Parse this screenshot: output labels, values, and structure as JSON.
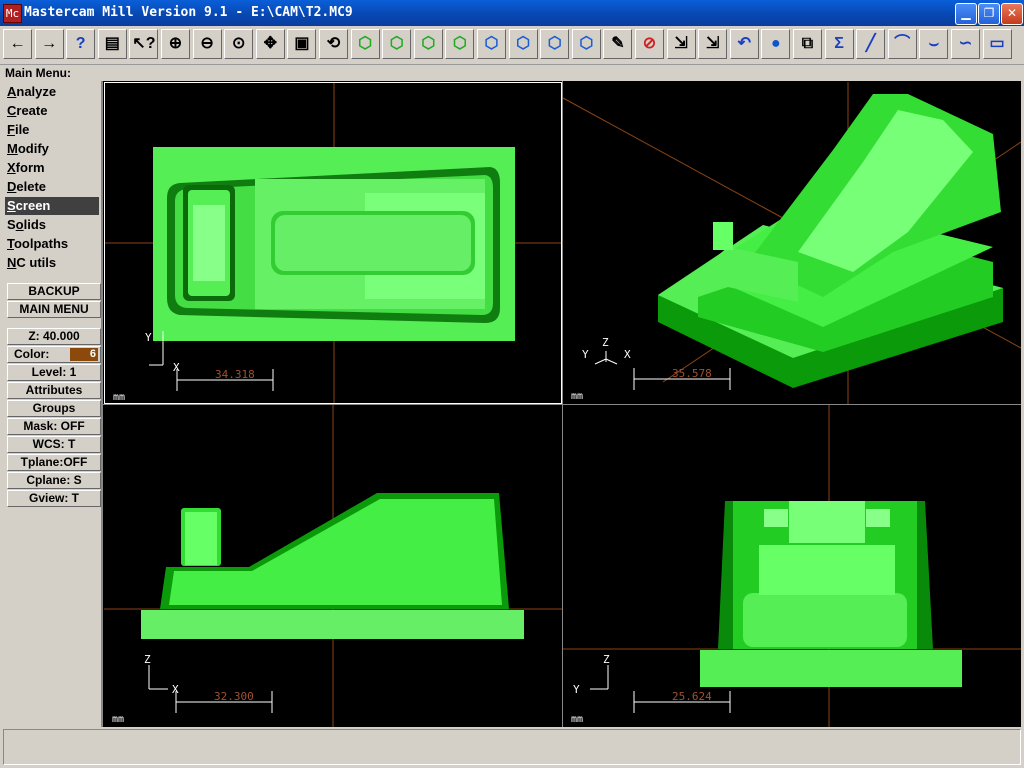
{
  "window": {
    "title": "Mastercam Mill Version 9.1 - E:\\CAM\\T2.MC9",
    "app_icon": "Mc"
  },
  "window_buttons": {
    "minimize": "▁",
    "maximize": "❐",
    "close": "✕"
  },
  "toolbar": {
    "buttons": [
      {
        "name": "back-icon",
        "glyph": "←"
      },
      {
        "name": "forward-icon",
        "glyph": "→"
      },
      {
        "name": "help-icon",
        "glyph": "?"
      },
      {
        "name": "file-cabinet-icon",
        "glyph": "▤"
      },
      {
        "name": "analyze-icon",
        "glyph": "↖?"
      },
      {
        "name": "zoom-icon",
        "glyph": "⊕"
      },
      {
        "name": "unzoom-icon",
        "glyph": "⊖"
      },
      {
        "name": "zoom-fit-icon",
        "glyph": "⊙"
      },
      {
        "name": "pan-icon",
        "glyph": "✥"
      },
      {
        "name": "select-icon",
        "glyph": "▣"
      },
      {
        "name": "rotate-icon",
        "glyph": "⟲"
      },
      {
        "name": "view-iso-green-icon",
        "glyph": "⬡"
      },
      {
        "name": "view-front-green-icon",
        "glyph": "⬡"
      },
      {
        "name": "view-side-green-icon",
        "glyph": "⬡"
      },
      {
        "name": "view-top-green-icon",
        "glyph": "⬡"
      },
      {
        "name": "view-iso-blue-icon",
        "glyph": "⬡"
      },
      {
        "name": "view-front-blue-icon",
        "glyph": "⬡"
      },
      {
        "name": "view-side-blue-icon",
        "glyph": "⬡"
      },
      {
        "name": "view-top-blue-icon",
        "glyph": "⬡"
      },
      {
        "name": "pencil-icon",
        "glyph": "✎"
      },
      {
        "name": "erase-icon",
        "glyph": "⊘"
      },
      {
        "name": "transform-icon",
        "glyph": "⇲"
      },
      {
        "name": "transform-multi-icon",
        "glyph": "⇲"
      },
      {
        "name": "undo-icon",
        "glyph": "↶"
      },
      {
        "name": "sphere-icon",
        "glyph": "●"
      },
      {
        "name": "scale-icon",
        "glyph": "⧉"
      },
      {
        "name": "sum-icon",
        "glyph": "Σ"
      },
      {
        "name": "line-icon",
        "glyph": "╱"
      },
      {
        "name": "arc-icon",
        "glyph": "⌒"
      },
      {
        "name": "fillet-icon",
        "glyph": "⌣"
      },
      {
        "name": "spline-icon",
        "glyph": "∽"
      },
      {
        "name": "rectangle-icon",
        "glyph": "▭"
      }
    ]
  },
  "main_menu": {
    "label": "Main Menu:",
    "items": [
      {
        "label": "Analyze",
        "hot": "A"
      },
      {
        "label": "Create",
        "hot": "C"
      },
      {
        "label": "File",
        "hot": "F"
      },
      {
        "label": "Modify",
        "hot": "M"
      },
      {
        "label": "Xform",
        "hot": "X"
      },
      {
        "label": "Delete",
        "hot": "D"
      },
      {
        "label": "Screen",
        "hot": "S"
      },
      {
        "label": "Solids",
        "hot": "o"
      },
      {
        "label": "Toolpaths",
        "hot": "T"
      },
      {
        "label": "NC utils",
        "hot": "N"
      }
    ],
    "active_item": "Screen",
    "backup": "BACKUP",
    "main_menu_button": "MAIN MENU"
  },
  "secondary_menu": {
    "z": "Z:  40.000",
    "color_label": "Color:",
    "color_value": "6",
    "level": "Level:  1",
    "attributes": "Attributes",
    "groups": "Groups",
    "mask": "Mask:  OFF",
    "wcs": "WCS:   T",
    "tplane": "Tplane:OFF",
    "cplane": "Cplane:  S",
    "gview": "Gview:   T"
  },
  "viewports": {
    "top_left": {
      "scale": "34.318",
      "units": "mm",
      "axis_v": "Y",
      "axis_h": "X"
    },
    "top_right": {
      "scale": "35.578",
      "units": "mm",
      "axis_z": "Z",
      "axis_y": "Y",
      "axis_x": "X"
    },
    "bottom_left": {
      "scale": "32.300",
      "units": "mm",
      "axis_v": "Z",
      "axis_h": "X"
    },
    "bottom_right": {
      "scale": "25.624",
      "units": "mm",
      "axis_v": "Z",
      "axis_h": "Y"
    }
  },
  "colors": {
    "model": "#22ee22",
    "model_light": "#66ff66",
    "model_dark": "#0a8a0a",
    "scale_text": "#a0522d",
    "axis": "#8b4513"
  }
}
